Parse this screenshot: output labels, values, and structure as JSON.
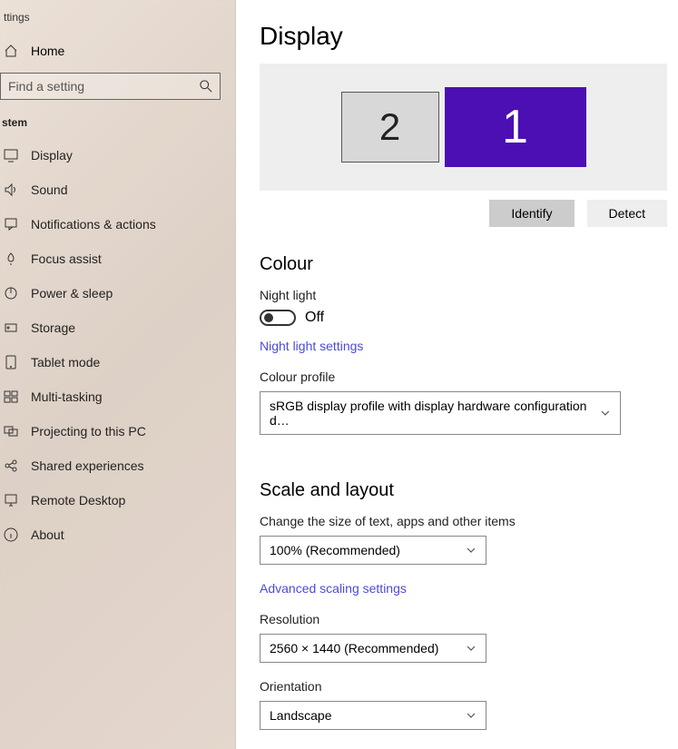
{
  "app_title": "ttings",
  "sidebar": {
    "home": "Home",
    "search_placeholder": "Find a setting",
    "category": "stem",
    "items": [
      {
        "label": "Display"
      },
      {
        "label": "Sound"
      },
      {
        "label": "Notifications & actions"
      },
      {
        "label": "Focus assist"
      },
      {
        "label": "Power & sleep"
      },
      {
        "label": "Storage"
      },
      {
        "label": "Tablet mode"
      },
      {
        "label": "Multi-tasking"
      },
      {
        "label": "Projecting to this PC"
      },
      {
        "label": "Shared experiences"
      },
      {
        "label": "Remote Desktop"
      },
      {
        "label": "About"
      }
    ]
  },
  "main": {
    "title": "Display",
    "monitors": {
      "primary": "1",
      "secondary": "2"
    },
    "identify_btn": "Identify",
    "detect_btn": "Detect",
    "colour": {
      "heading": "Colour",
      "night_light_label": "Night light",
      "night_light_state": "Off",
      "night_light_link": "Night light settings",
      "profile_label": "Colour profile",
      "profile_value": "sRGB display profile with display hardware configuration d…"
    },
    "scale": {
      "heading": "Scale and layout",
      "size_label": "Change the size of text, apps and other items",
      "size_value": "100% (Recommended)",
      "advanced_link": "Advanced scaling settings",
      "resolution_label": "Resolution",
      "resolution_value": "2560 × 1440 (Recommended)",
      "orientation_label": "Orientation",
      "orientation_value": "Landscape"
    }
  }
}
